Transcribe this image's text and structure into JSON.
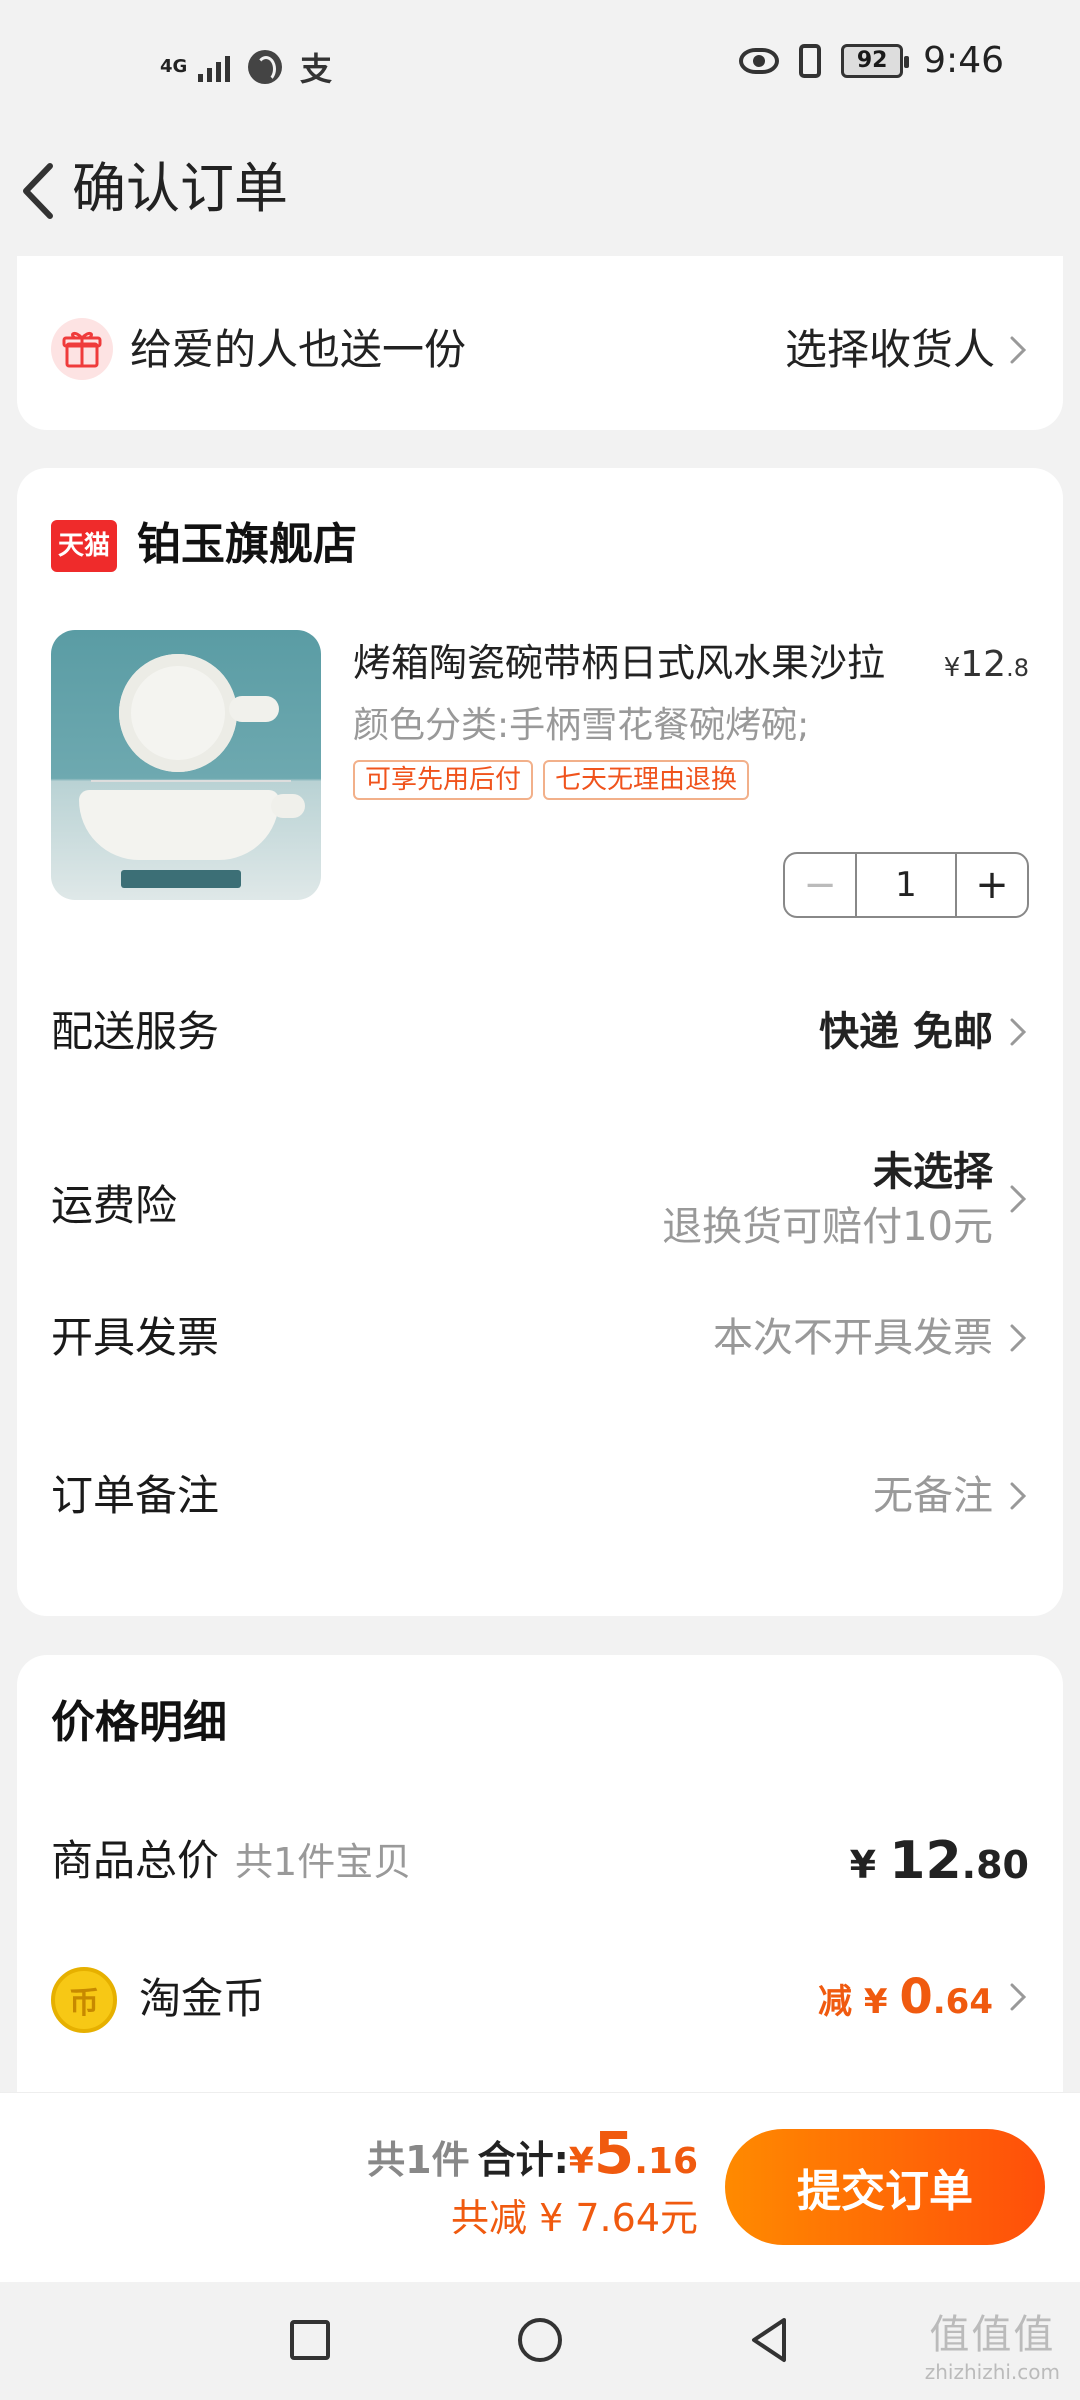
{
  "status_bar": {
    "network": "4G",
    "alipay_glyph": "支",
    "battery": "92",
    "time": "9:46"
  },
  "header": {
    "title": "确认订单"
  },
  "gift": {
    "label": "给爱的人也送一份",
    "action": "选择收货人"
  },
  "store": {
    "badge": "天猫",
    "name": "铂玉旗舰店"
  },
  "product": {
    "title": "烤箱陶瓷碗带柄日式风水果沙拉",
    "price_currency": "¥",
    "price_int": "12",
    "price_dec": ".8",
    "spec": "颜色分类:手柄雪花餐碗烤碗;",
    "tags": [
      "可享先用后付",
      "七天无理由退换"
    ],
    "quantity": "1",
    "minus": "−",
    "plus": "+"
  },
  "rows": {
    "delivery": {
      "label": "配送服务",
      "value": "快递 免邮"
    },
    "insurance": {
      "label": "运费险",
      "value": "未选择",
      "sub": "退换货可赔付10元"
    },
    "invoice": {
      "label": "开具发票",
      "value": "本次不开具发票"
    },
    "note": {
      "label": "订单备注",
      "value": "无备注"
    }
  },
  "price_detail": {
    "title": "价格明细",
    "total_label": "商品总价",
    "total_sub": "共1件宝贝",
    "total_currency": "¥",
    "total_int": "12",
    "total_dec": ".80",
    "coin_label": "淘金币",
    "coin_glyph": "币",
    "coin_prefix": "减",
    "coin_currency": "¥",
    "coin_int": "0",
    "coin_dec": ".64"
  },
  "bottom": {
    "count": "共1件",
    "sum_label": "合计:",
    "sum_currency": "¥",
    "sum_int": "5",
    "sum_dec": ".16",
    "save_text": "共减 ¥ 7.64元",
    "submit": "提交订单"
  },
  "watermark": {
    "big": "值值值",
    "small": "zhizhizhi.com"
  },
  "colors": {
    "accent": "#f05a0f",
    "tmall_red": "#ef2b2b",
    "submit_gradient_start": "#ff8a00",
    "submit_gradient_end": "#ff4f0a"
  }
}
